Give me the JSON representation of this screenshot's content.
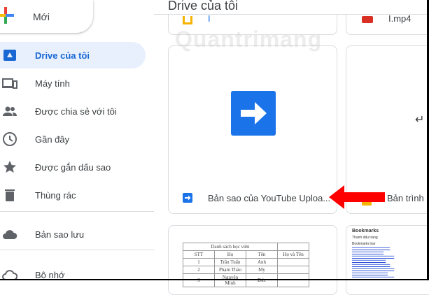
{
  "new_button": {
    "label": "Mới"
  },
  "sidebar": {
    "items": [
      {
        "label": "Drive của tôi",
        "icon": "drive-icon"
      },
      {
        "label": "Máy tính",
        "icon": "computer-icon"
      },
      {
        "label": "Được chia sẻ với tôi",
        "icon": "shared-icon"
      },
      {
        "label": "Gần đây",
        "icon": "clock-icon"
      },
      {
        "label": "Được gắn dấu sao",
        "icon": "star-icon"
      },
      {
        "label": "Thùng rác",
        "icon": "trash-icon"
      },
      {
        "label": "Bản sao lưu",
        "icon": "cloud-icon"
      },
      {
        "label": "Bộ nhớ",
        "icon": "cloud-storage-icon"
      }
    ]
  },
  "main": {
    "title": "Drive của tôi",
    "files": [
      {
        "name": "I",
        "type": "folder"
      },
      {
        "name": "I.mp4",
        "type": "video"
      },
      {
        "name": "Bản sao của YouTube Uploa...",
        "type": "shortcut"
      },
      {
        "name": "Bản trình b",
        "type": "slides"
      }
    ],
    "preview_table": {
      "title": "Danh sách học viên",
      "headers": [
        "STT",
        "Họ",
        "Tên",
        "Họ và Tên"
      ],
      "rows": [
        [
          "1",
          "Trần Tuấn",
          "Anh",
          ""
        ],
        [
          "2",
          "Phạm Thảo",
          "My",
          ""
        ],
        [
          "3",
          "Nguyễn Minh",
          "Đức",
          ""
        ]
      ]
    },
    "preview_bookmarks": {
      "title": "Bookmarks",
      "sub1": "Thanh dấu trang",
      "sub2": "Bookmarks bar"
    }
  },
  "watermark": "Quantrimang",
  "colors": {
    "accent": "#1a73e8",
    "active_bg": "#e8f0fe",
    "arrow": "#ff0000"
  }
}
